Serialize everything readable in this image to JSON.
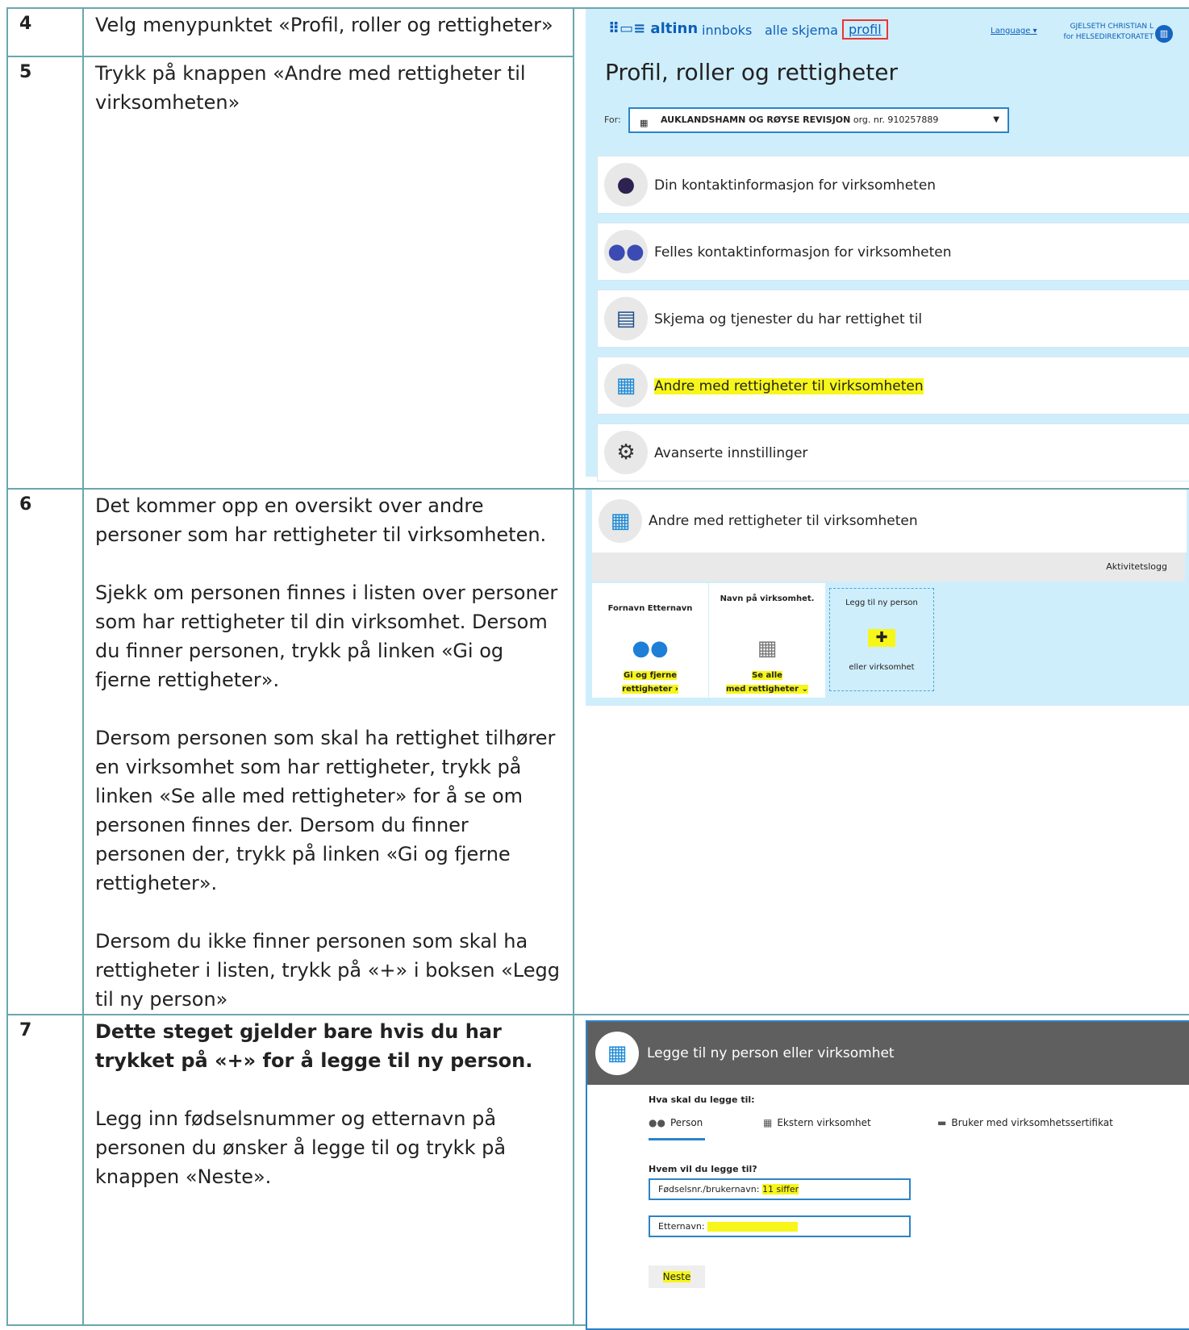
{
  "steps": {
    "s4": {
      "number": "4",
      "text": "Velg menypunktet «Profil, roller og rettigheter»"
    },
    "s5": {
      "number": "5",
      "text": "Trykk på knappen «Andre med rettigheter til virksomheten»"
    },
    "s6": {
      "number": "6",
      "p1": "Det kommer opp en oversikt over andre personer som har rettigheter til virksomheten.",
      "p2": "Sjekk om personen finnes i listen over personer som har rettigheter til din virksomhet. Dersom du finner personen, trykk på linken «Gi og fjerne rettigheter».",
      "p3": "Dersom personen som skal ha rettighet tilhører en virksomhet som har rettigheter, trykk på linken «Se alle med rettigheter» for å se om personen finnes der. Dersom du finner personen der, trykk på linken «Gi og fjerne rettigheter».",
      "p4": "Dersom du ikke finner personen som skal ha rettigheter i listen, trykk på «+» i boksen «Legg til ny person»"
    },
    "s7": {
      "number": "7",
      "p1": "Dette steget gjelder bare hvis du har trykket på «+» for å legge til ny person.",
      "p2": "Legg inn fødselsnummer og etternavn på personen du ønsker å legge til og trykk på knappen «Neste»."
    }
  },
  "altinn": {
    "logo": "altinn",
    "nav": [
      "innboks",
      "alle skjema",
      "profil"
    ],
    "language": "Language",
    "user_line1": "GJELSETH CHRISTIAN L",
    "user_line2": "for HELSEDIREKTORATET",
    "page_title": "Profil, roller og rettigheter",
    "for_label": "For:",
    "for_org": "AUKLANDSHAMN OG RØYSE REVISJON",
    "for_orgnr": "org. nr. 910257889",
    "menu": [
      {
        "label": "Din kontaktinformasjon for virksomheten",
        "icon": "person-icon"
      },
      {
        "label": "Felles kontaktinformasjon for virksomheten",
        "icon": "group-icon"
      },
      {
        "label": "Skjema og tjenester du har rettighet til",
        "icon": "clipboard-icon"
      },
      {
        "label": "Andre med rettigheter til virksomheten",
        "icon": "buildings-icon"
      },
      {
        "label": "Avanserte innstillinger",
        "icon": "gears-icon"
      }
    ]
  },
  "rights": {
    "header": "Andre med rettigheter til virksomheten",
    "activity_log": "Aktivitetslogg",
    "tile1_title": "Fornavn Etternavn",
    "tile1_link1": "Gi og fjerne",
    "tile1_link2": "rettigheter ›",
    "tile2_title": "Navn på virksomhet.",
    "tile2_link1": "Se alle",
    "tile2_link2": "med rettigheter ⌄",
    "add_title": "Legg til ny person",
    "add_plus": "✚",
    "add_sub": "eller virksomhet"
  },
  "modal": {
    "title": "Legge til ny person eller virksomhet",
    "q1": "Hva skal du legge til:",
    "opt_person": "Person",
    "opt_ext": "Ekstern virksomhet",
    "opt_cert": "Bruker med virksomhetssertifikat",
    "q2": "Hvem vil du legge til?",
    "field1_label": "Fødselsnr./brukernavn:",
    "field1_value": "11 siffer",
    "field2_label": "Etternavn:",
    "next": "Neste"
  }
}
